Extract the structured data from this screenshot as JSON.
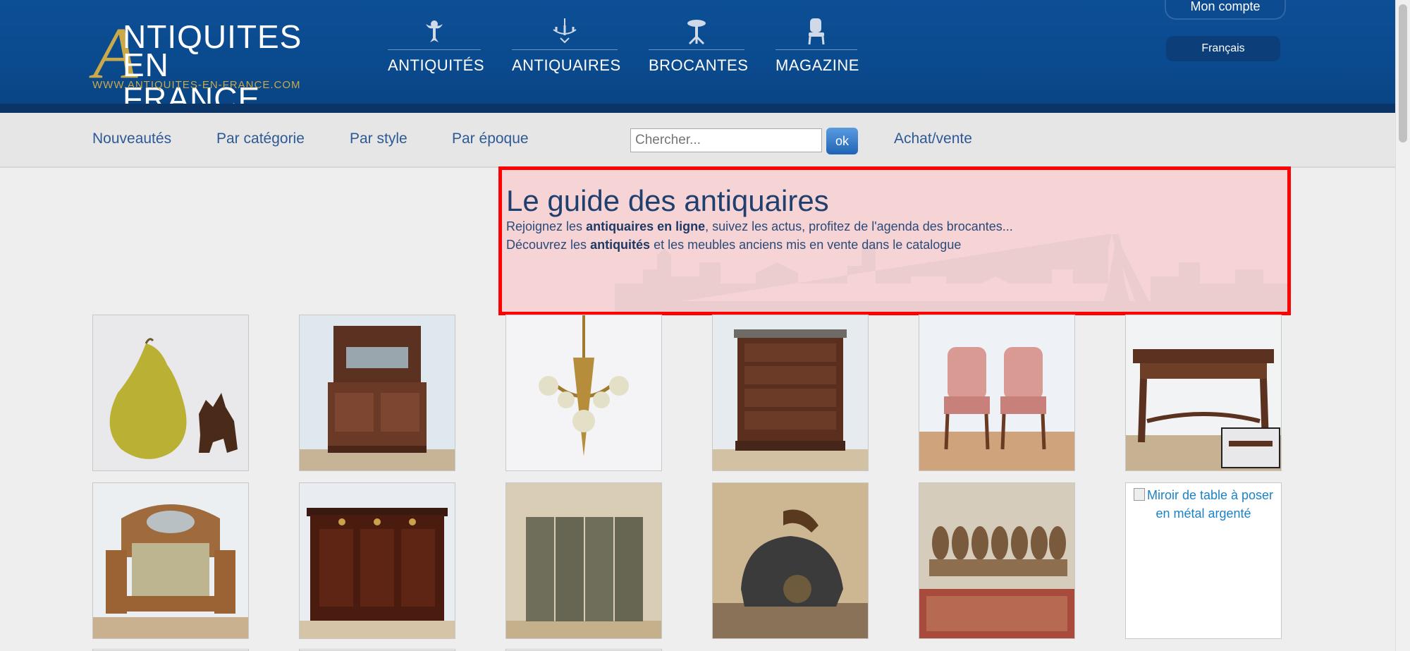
{
  "header": {
    "logo": {
      "big_letter": "A",
      "line1": "NTIQUITES",
      "line2": "EN FRANCE",
      "url": "WWW.ANTIQUITES-EN-FRANCE.COM"
    },
    "nav": [
      {
        "label": "ANTIQUITÉS",
        "icon": "cherub-icon"
      },
      {
        "label": "ANTIQUAIRES",
        "icon": "chandelier-icon"
      },
      {
        "label": "BROCANTES",
        "icon": "side-table-icon"
      },
      {
        "label": "MAGAZINE",
        "icon": "chair-icon"
      }
    ],
    "account": "Mon compte",
    "language": "Français"
  },
  "subnav": {
    "links": [
      "Nouveautés",
      "Par catégorie",
      "Par style",
      "Par époque"
    ],
    "search_placeholder": "Chercher...",
    "search_button": "ok",
    "buy_sell": "Achat/vente"
  },
  "hero": {
    "title": "Le guide des antiquaires",
    "line1_pre": "Rejoignez les ",
    "line1_bold": "antiquaires en ligne",
    "line1_post": ", suivez les actus, profitez de l'agenda des brocantes...",
    "line2_pre": "Découvrez les ",
    "line2_bold": "antiquités",
    "line2_post": " et les meubles anciens mis en vente dans le catalogue"
  },
  "products": [
    {
      "name": "pear-and-dog-figurine"
    },
    {
      "name": "buffet-mirror-sideboard"
    },
    {
      "name": "bronze-chandelier"
    },
    {
      "name": "walnut-chest-of-drawers"
    },
    {
      "name": "pair-of-armchairs"
    },
    {
      "name": "wooden-table"
    },
    {
      "name": "vanity-sofa-bench"
    },
    {
      "name": "mahogany-cabinet"
    },
    {
      "name": "folding-screen"
    },
    {
      "name": "antique-helmet"
    },
    {
      "name": "set-of-chairs"
    },
    {
      "name": "miroir-table",
      "alt": "Miroir de table à poser en métal argenté"
    }
  ],
  "colors": {
    "header_blue": "#0a4a8e",
    "link_blue": "#2d5a94",
    "gold": "#c9a94a",
    "highlight_red": "#ff0000"
  }
}
